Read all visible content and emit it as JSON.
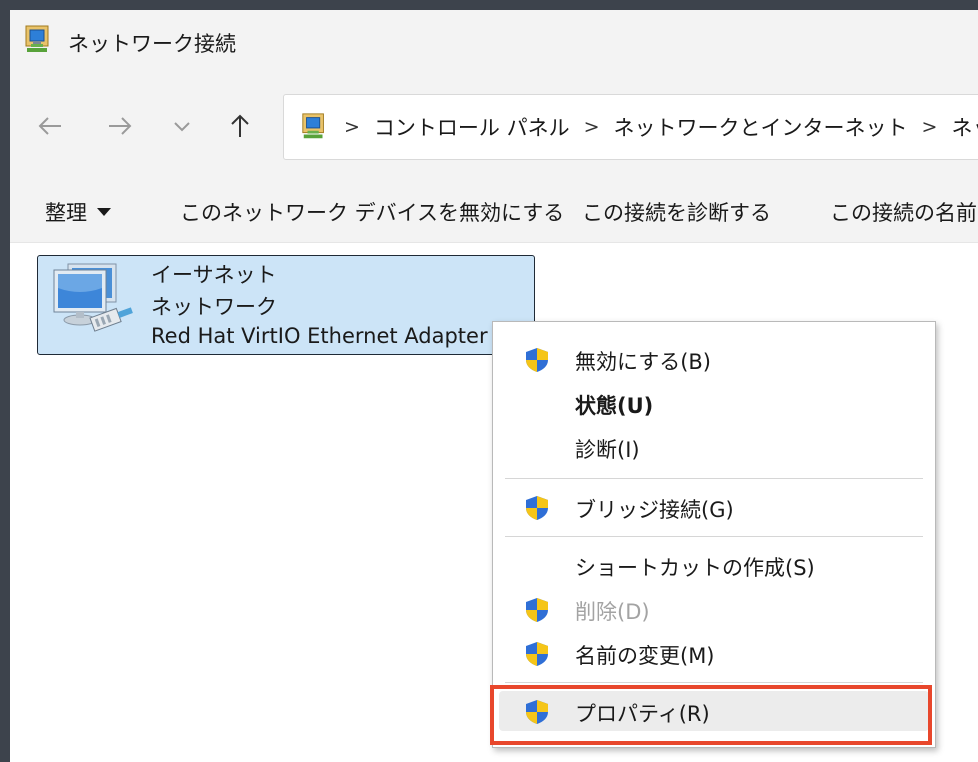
{
  "window": {
    "title": "ネットワーク接続"
  },
  "nav": {
    "back_icon": "arrow-left-icon",
    "forward_icon": "arrow-right-icon",
    "recent_icon": "chevron-down-icon",
    "up_icon": "arrow-up-icon"
  },
  "address": {
    "crumbs": [
      "コントロール パネル",
      "ネットワークとインターネット",
      "ネットワーク"
    ],
    "separator": ">"
  },
  "commands": {
    "organize": "整理",
    "disable_device": "このネットワーク デバイスを無効にする",
    "diagnose": "この接続を診断する",
    "rename": "この接続の名前"
  },
  "connection": {
    "name": "イーサネット",
    "status": "ネットワーク",
    "adapter": "Red Hat VirtIO Ethernet Adapter"
  },
  "context_menu": {
    "items": [
      {
        "label": "無効にする(B)",
        "shield": true
      },
      {
        "label": "状態(U)",
        "shield": false,
        "bold": true
      },
      {
        "label": "診断(I)",
        "shield": false
      },
      {
        "label": "ブリッジ接続(G)",
        "shield": true
      },
      {
        "label": "ショートカットの作成(S)",
        "shield": false
      },
      {
        "label": "削除(D)",
        "shield": true,
        "disabled": true
      },
      {
        "label": "名前の変更(M)",
        "shield": true
      },
      {
        "label": "プロパティ(R)",
        "shield": true,
        "highlighted": true
      }
    ]
  },
  "colors": {
    "selection": "#cce4f7",
    "highlight_border": "#e8472c",
    "chrome": "#f3f3f3",
    "shield_blue": "#2f6fd6",
    "shield_yellow": "#f5c518"
  }
}
